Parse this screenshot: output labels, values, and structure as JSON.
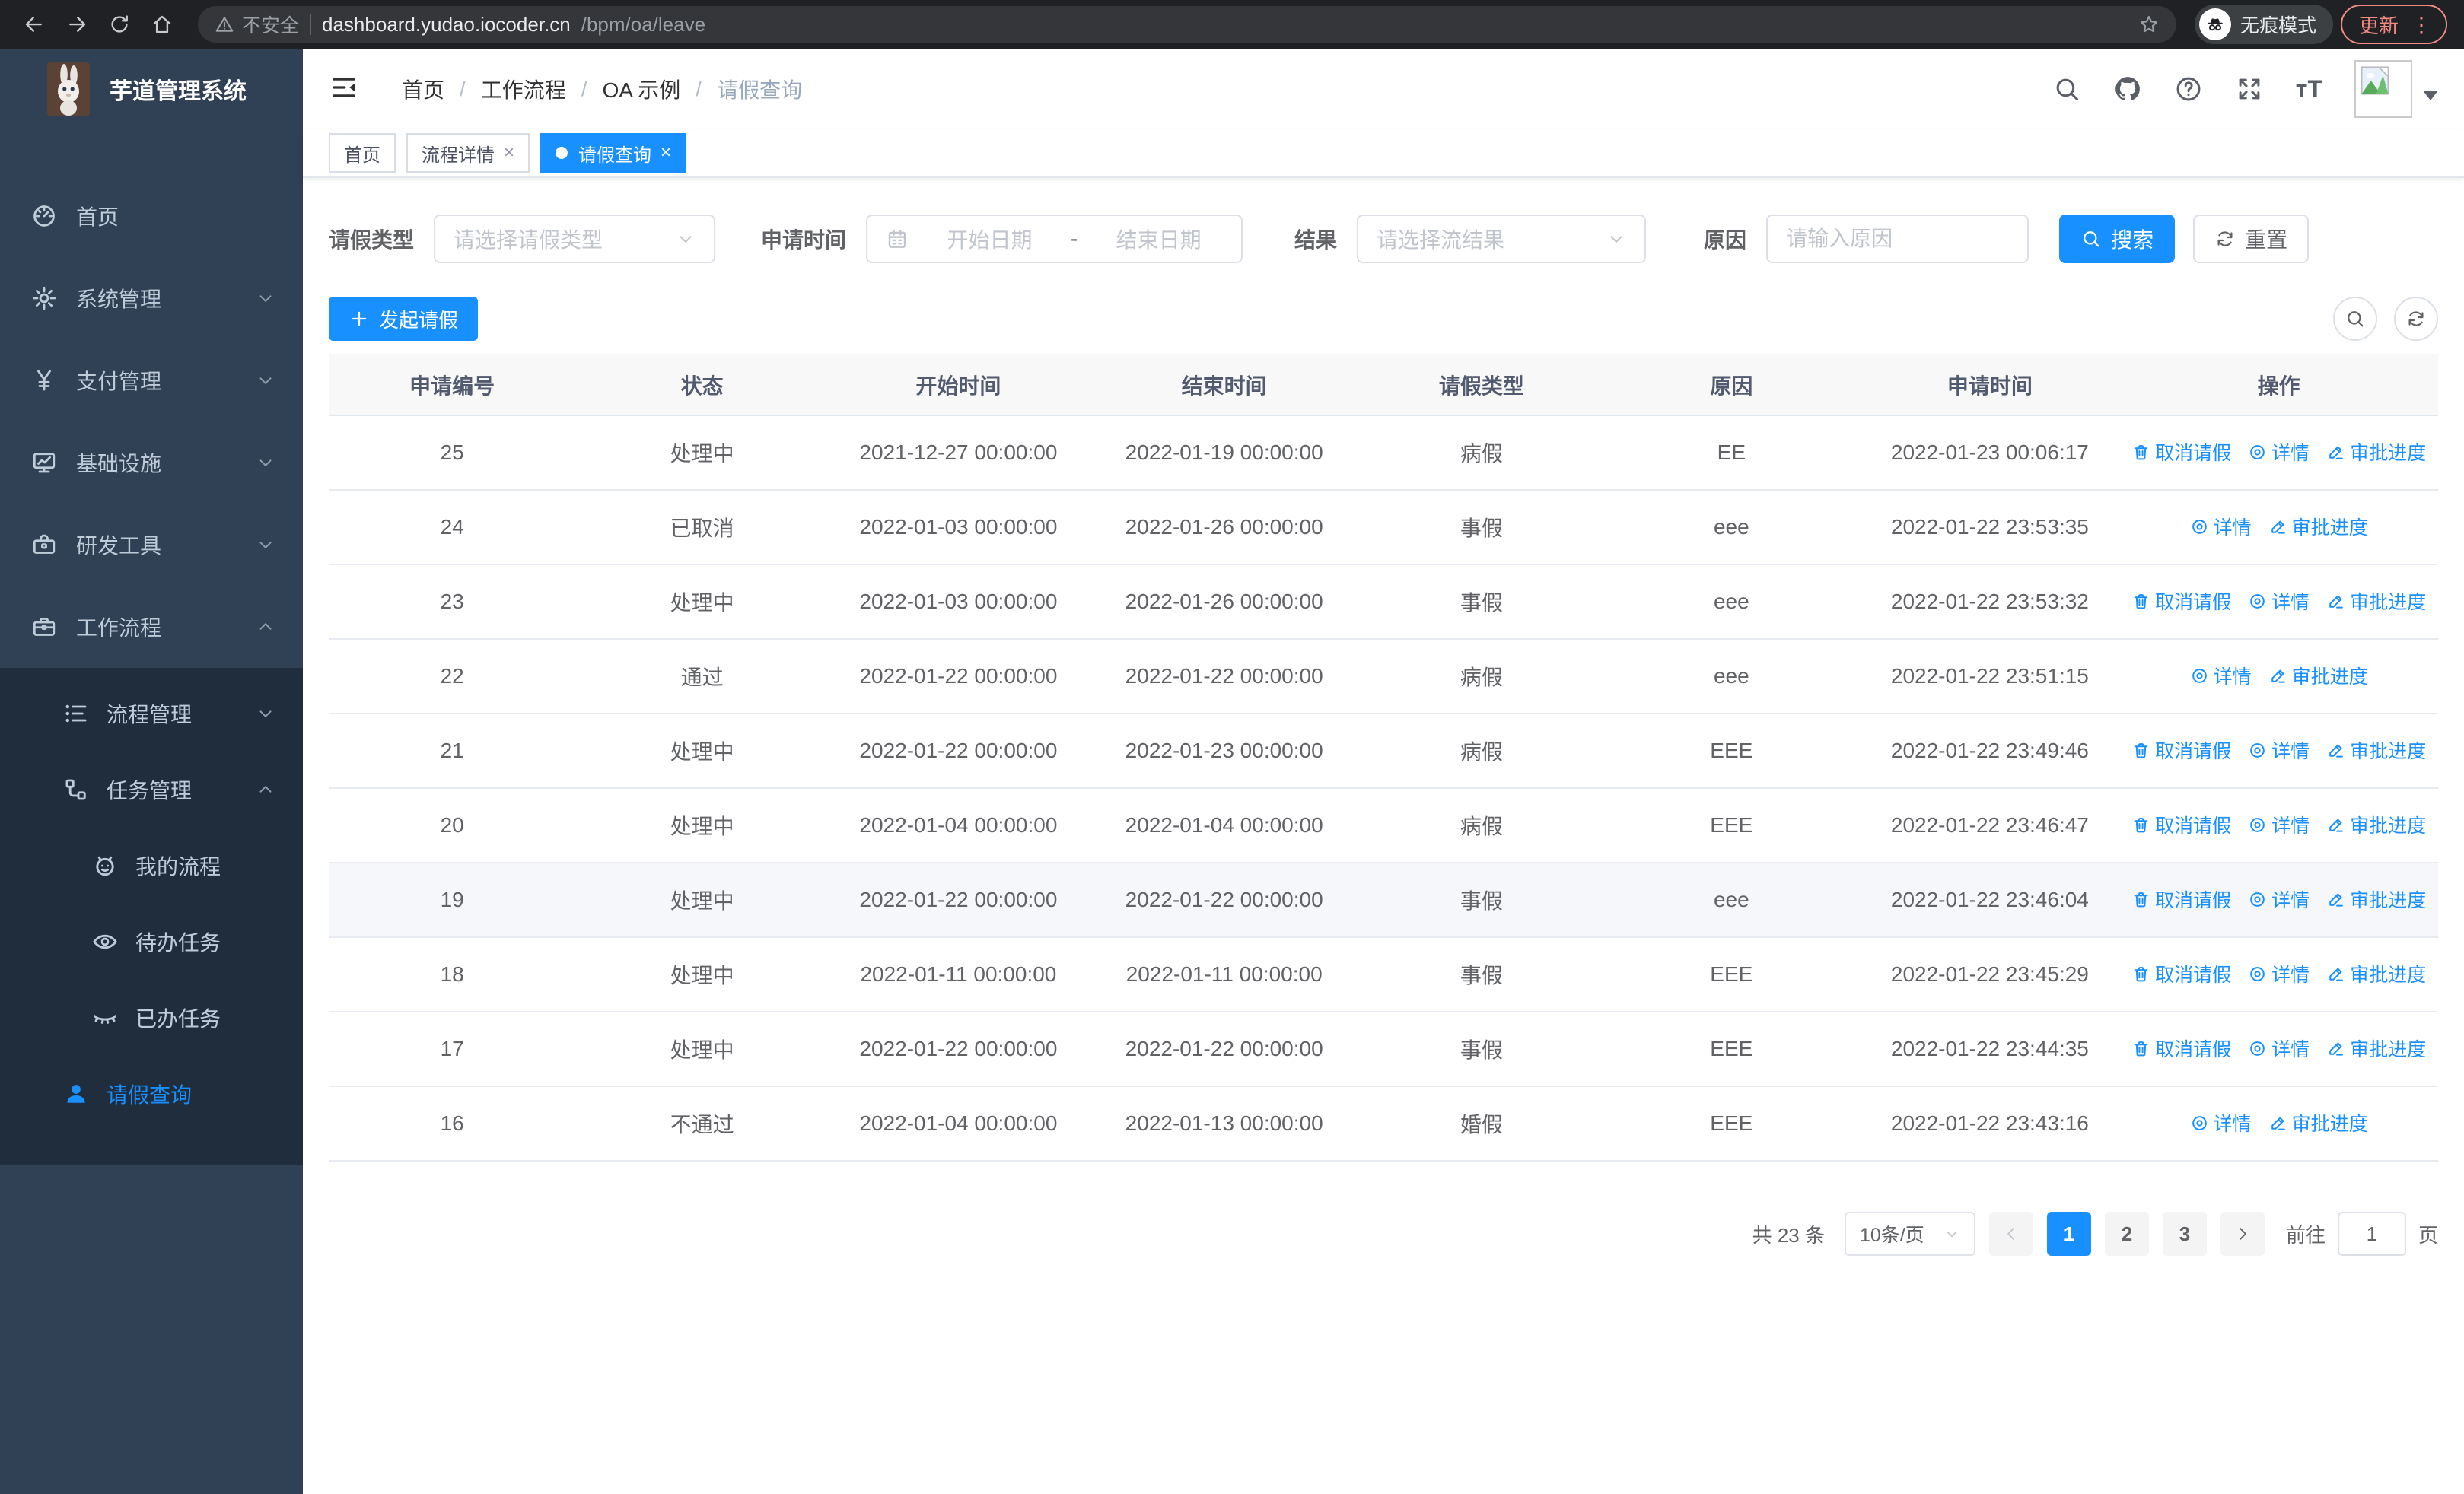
{
  "colors": {
    "primary": "#1890ff",
    "sidebar_bg": "#304156",
    "submenu_bg": "#1f2d3d",
    "chrome_bg": "#202124",
    "update_accent": "#f28b82",
    "table_header_bg": "#f8f8f9"
  },
  "browser": {
    "security_label": "不安全",
    "url_host": "dashboard.yudao.iocoder.cn",
    "url_path": "/bpm/oa/leave",
    "incognito_label": "无痕模式",
    "update_label": "更新"
  },
  "sidebar": {
    "brand": "芋道管理系统",
    "menu": [
      {
        "icon": "dashboard-icon",
        "label": "首页",
        "arrow": ""
      },
      {
        "icon": "gear-icon",
        "label": "系统管理",
        "arrow": "down"
      },
      {
        "icon": "yen-icon",
        "label": "支付管理",
        "arrow": "down"
      },
      {
        "icon": "monitor-icon",
        "label": "基础设施",
        "arrow": "down"
      },
      {
        "icon": "toolbox-icon",
        "label": "研发工具",
        "arrow": "down"
      },
      {
        "icon": "briefcase-icon",
        "label": "工作流程",
        "arrow": "up"
      }
    ],
    "submenu": [
      {
        "icon": "list-icon",
        "label": "流程管理",
        "arrow": "down",
        "level": 2,
        "active": false
      },
      {
        "icon": "tree-icon",
        "label": "任务管理",
        "arrow": "up",
        "level": 2,
        "active": false
      },
      {
        "icon": "robot-icon",
        "label": "我的流程",
        "arrow": "",
        "level": 3,
        "active": false
      },
      {
        "icon": "eye-icon",
        "label": "待办任务",
        "arrow": "",
        "level": 3,
        "active": false
      },
      {
        "icon": "eye-closed-icon",
        "label": "已办任务",
        "arrow": "",
        "level": 3,
        "active": false
      },
      {
        "icon": "user-icon",
        "label": "请假查询",
        "arrow": "",
        "level": 2,
        "active": true
      }
    ]
  },
  "header": {
    "breadcrumb": [
      "首页",
      "工作流程",
      "OA 示例",
      "请假查询"
    ],
    "separator": "/"
  },
  "tabs": [
    {
      "label": "首页",
      "closable": false,
      "active": false
    },
    {
      "label": "流程详情",
      "closable": true,
      "active": false
    },
    {
      "label": "请假查询",
      "closable": true,
      "active": true
    }
  ],
  "filters": {
    "type_label": "请假类型",
    "type_placeholder": "请选择请假类型",
    "time_label": "申请时间",
    "start_placeholder": "开始日期",
    "range_separator": "-",
    "end_placeholder": "结束日期",
    "result_label": "结果",
    "result_placeholder": "请选择流结果",
    "reason_label": "原因",
    "reason_placeholder": "请输入原因",
    "search_label": "搜索",
    "reset_label": "重置"
  },
  "toolbar": {
    "create_label": "发起请假"
  },
  "table": {
    "columns": [
      "申请编号",
      "状态",
      "开始时间",
      "结束时间",
      "请假类型",
      "原因",
      "申请时间",
      "操作"
    ],
    "action_labels": {
      "cancel": "取消请假",
      "detail": "详情",
      "progress": "审批进度"
    },
    "rows": [
      {
        "id": "25",
        "status": "处理中",
        "start": "2021-12-27 00:00:00",
        "end": "2022-01-19 00:00:00",
        "type": "病假",
        "reason": "EE",
        "applied": "2022-01-23 00:06:17",
        "actions": [
          "cancel",
          "detail",
          "progress"
        ],
        "highlight": false
      },
      {
        "id": "24",
        "status": "已取消",
        "start": "2022-01-03 00:00:00",
        "end": "2022-01-26 00:00:00",
        "type": "事假",
        "reason": "eee",
        "applied": "2022-01-22 23:53:35",
        "actions": [
          "detail",
          "progress"
        ],
        "highlight": false
      },
      {
        "id": "23",
        "status": "处理中",
        "start": "2022-01-03 00:00:00",
        "end": "2022-01-26 00:00:00",
        "type": "事假",
        "reason": "eee",
        "applied": "2022-01-22 23:53:32",
        "actions": [
          "cancel",
          "detail",
          "progress"
        ],
        "highlight": false
      },
      {
        "id": "22",
        "status": "通过",
        "start": "2022-01-22 00:00:00",
        "end": "2022-01-22 00:00:00",
        "type": "病假",
        "reason": "eee",
        "applied": "2022-01-22 23:51:15",
        "actions": [
          "detail",
          "progress"
        ],
        "highlight": false
      },
      {
        "id": "21",
        "status": "处理中",
        "start": "2022-01-22 00:00:00",
        "end": "2022-01-23 00:00:00",
        "type": "病假",
        "reason": "EEE",
        "applied": "2022-01-22 23:49:46",
        "actions": [
          "cancel",
          "detail",
          "progress"
        ],
        "highlight": false
      },
      {
        "id": "20",
        "status": "处理中",
        "start": "2022-01-04 00:00:00",
        "end": "2022-01-04 00:00:00",
        "type": "病假",
        "reason": "EEE",
        "applied": "2022-01-22 23:46:47",
        "actions": [
          "cancel",
          "detail",
          "progress"
        ],
        "highlight": false
      },
      {
        "id": "19",
        "status": "处理中",
        "start": "2022-01-22 00:00:00",
        "end": "2022-01-22 00:00:00",
        "type": "事假",
        "reason": "eee",
        "applied": "2022-01-22 23:46:04",
        "actions": [
          "cancel",
          "detail",
          "progress"
        ],
        "highlight": true
      },
      {
        "id": "18",
        "status": "处理中",
        "start": "2022-01-11 00:00:00",
        "end": "2022-01-11 00:00:00",
        "type": "事假",
        "reason": "EEE",
        "applied": "2022-01-22 23:45:29",
        "actions": [
          "cancel",
          "detail",
          "progress"
        ],
        "highlight": false
      },
      {
        "id": "17",
        "status": "处理中",
        "start": "2022-01-22 00:00:00",
        "end": "2022-01-22 00:00:00",
        "type": "事假",
        "reason": "EEE",
        "applied": "2022-01-22 23:44:35",
        "actions": [
          "cancel",
          "detail",
          "progress"
        ],
        "highlight": false
      },
      {
        "id": "16",
        "status": "不通过",
        "start": "2022-01-04 00:00:00",
        "end": "2022-01-13 00:00:00",
        "type": "婚假",
        "reason": "EEE",
        "applied": "2022-01-22 23:43:16",
        "actions": [
          "detail",
          "progress"
        ],
        "highlight": false
      }
    ]
  },
  "pagination": {
    "total_label": "共 23 条",
    "page_size": "10条/页",
    "pages": [
      "1",
      "2",
      "3"
    ],
    "active_page": "1",
    "goto_label": "前往",
    "goto_value": "1",
    "page_unit": "页"
  }
}
